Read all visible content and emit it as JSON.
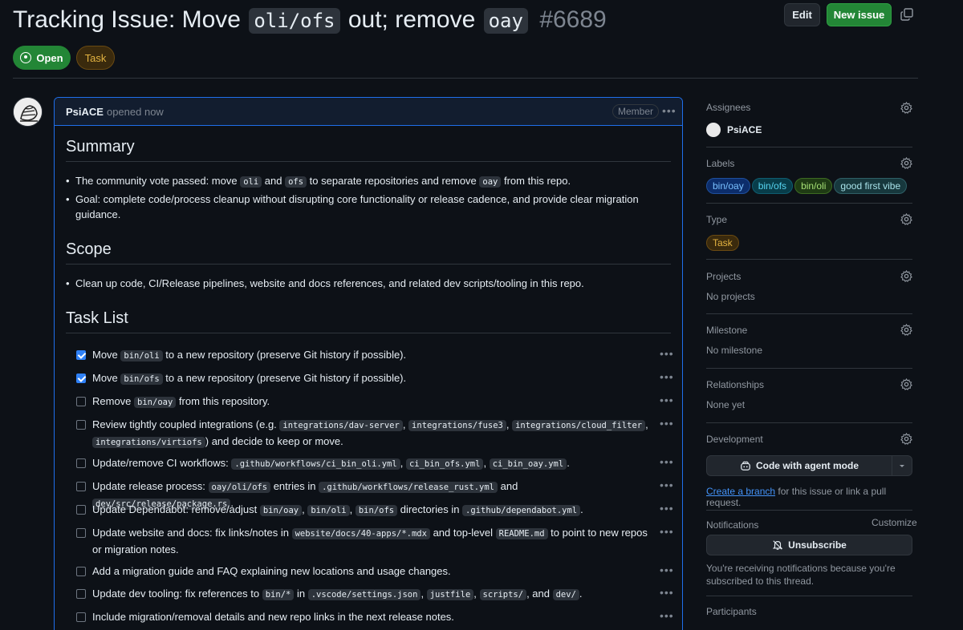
{
  "header": {
    "title_parts": [
      "Tracking Issue: Move",
      "oli/ofs",
      "out; remove",
      "oay"
    ],
    "issue_number": "#6689",
    "edit_label": "Edit",
    "new_issue_label": "New issue",
    "state_label": "Open",
    "type_label": "Task"
  },
  "comment": {
    "author": "PsiACE",
    "meta": "opened now",
    "role_badge": "Member",
    "summary_heading": "Summary",
    "summary_bullets": [
      [
        "The community vote passed: move ",
        "oli",
        " and ",
        "ofs",
        " to separate repositories and remove ",
        "oay",
        " from this repo."
      ],
      [
        "Goal: complete code/process cleanup without disrupting core functionality or release cadence, and provide clear migration guidance."
      ]
    ],
    "scope_heading": "Scope",
    "scope_bullets": [
      [
        "Clean up code, CI/Release pipelines, website and docs references, and related dev scripts/tooling in this repo."
      ]
    ],
    "tasklist_heading": "Task List",
    "tasks": [
      {
        "checked": true,
        "parts": [
          "Move ",
          "bin/oli",
          " to a new repository (preserve Git history if possible)."
        ]
      },
      {
        "checked": true,
        "parts": [
          "Move ",
          "bin/ofs",
          " to a new repository (preserve Git history if possible)."
        ]
      },
      {
        "checked": false,
        "parts": [
          "Remove ",
          "bin/oay",
          " from this repository."
        ]
      },
      {
        "checked": false,
        "parts": [
          "Review tightly coupled integrations (e.g. ",
          "integrations/dav-server",
          ", ",
          "integrations/fuse3",
          ", ",
          "integrations/cloud_filter",
          ", ",
          "integrations/virtiofs",
          ") and decide to keep or move."
        ]
      },
      {
        "checked": false,
        "parts": [
          "Update/remove CI workflows: ",
          ".github/workflows/ci_bin_oli.yml",
          ", ",
          "ci_bin_ofs.yml",
          ", ",
          "ci_bin_oay.yml",
          "."
        ]
      },
      {
        "checked": false,
        "parts": [
          "Update release process: ",
          "oay/oli/ofs",
          " entries in ",
          ".github/workflows/release_rust.yml",
          " and ",
          "dev/src/release/package.rs",
          "."
        ]
      },
      {
        "checked": false,
        "parts": [
          "Update Dependabot: remove/adjust ",
          "bin/oay",
          ", ",
          "bin/oli",
          ", ",
          "bin/ofs",
          " directories in ",
          ".github/dependabot.yml",
          "."
        ]
      },
      {
        "checked": false,
        "parts": [
          "Update website and docs: fix links/notes in ",
          "website/docs/40-apps/*.mdx",
          " and top-level ",
          "README.md",
          " to point to new repos or migration notes."
        ]
      },
      {
        "checked": false,
        "parts": [
          "Add a migration guide and FAQ explaining new locations and usage changes."
        ]
      },
      {
        "checked": false,
        "parts": [
          "Update dev tooling: fix references to ",
          "bin/*",
          " in ",
          ".vscode/settings.json",
          ", ",
          "justfile",
          ", ",
          "scripts/",
          ", and ",
          "dev/",
          "."
        ]
      },
      {
        "checked": false,
        "parts": [
          "Include migration/removal details and new repo links in the next release notes."
        ]
      }
    ]
  },
  "sidebar": {
    "assignees_title": "Assignees",
    "assignee": "PsiACE",
    "labels_title": "Labels",
    "labels": [
      {
        "text": "bin/oay",
        "bg": "#0c2d6b",
        "fg": "#79c0ff",
        "border": "#1f4f9c"
      },
      {
        "text": "bin/ofs",
        "bg": "#083d4a",
        "fg": "#56d4f0",
        "border": "#0e5d70"
      },
      {
        "text": "bin/oli",
        "bg": "#1f3b14",
        "fg": "#a5e075",
        "border": "#3d6b22"
      },
      {
        "text": "good first vibe",
        "bg": "#17383d",
        "fg": "#a8e2e9",
        "border": "#2f5f66"
      }
    ],
    "type_title": "Type",
    "type_value": "Task",
    "projects_title": "Projects",
    "projects_value": "No projects",
    "milestone_title": "Milestone",
    "milestone_value": "No milestone",
    "relationships_title": "Relationships",
    "relationships_value": "None yet",
    "development_title": "Development",
    "agent_button": "Code with agent mode",
    "dev_link": "Create a branch",
    "dev_text": " for this issue or link a pull request.",
    "notifications_title": "Notifications",
    "customize_label": "Customize",
    "unsubscribe_label": "Unsubscribe",
    "notif_text": "You're receiving notifications because you're subscribed to this thread.",
    "participants_title": "Participants"
  }
}
